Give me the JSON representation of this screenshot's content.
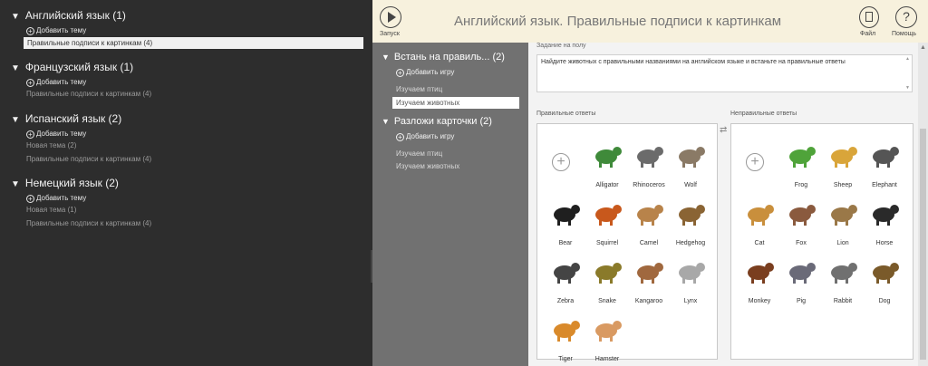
{
  "tree": {
    "languages": [
      {
        "title": "Английский язык (1)",
        "add_label": "Добавить тему",
        "topics": [
          "Правильные подписи к картинкам (4)"
        ],
        "selected": 0
      },
      {
        "title": "Французский язык (1)",
        "add_label": "Добавить тему",
        "topics": [
          "Правильные подписи к картинкам (4)"
        ],
        "selected": -1
      },
      {
        "title": "Испанский язык (2)",
        "add_label": "Добавить тему",
        "topics": [
          "Новая тема (2)",
          "Правильные подписи к картинкам (4)"
        ],
        "selected": -1
      },
      {
        "title": "Немецкий язык (2)",
        "add_label": "Добавить тему",
        "topics": [
          "Новая тема (1)",
          "Правильные подписи к картинкам (4)"
        ],
        "selected": -1
      }
    ]
  },
  "games": [
    {
      "title": "Встань на правиль... (2)",
      "add_label": "Добавить игру",
      "topics": [
        "Изучаем птиц",
        "Изучаем животных"
      ],
      "selected": 1
    },
    {
      "title": "Разложи карточки (2)",
      "add_label": "Добавить игру",
      "topics": [
        "Изучаем птиц",
        "Изучаем животных"
      ],
      "selected": -1
    }
  ],
  "toolbar": {
    "run_label": "Запуск",
    "title": "Английский язык. Правильные подписи к картинкам",
    "file_label": "Файл",
    "help_label": "Помощь"
  },
  "task": {
    "label": "Задание на полу",
    "text": "Найдите животных с правильными названиями на английском языке и встаньте на правильные ответы"
  },
  "answers": {
    "correct_label": "Правильные ответы",
    "wrong_label": "Неправильные ответы",
    "correct": [
      "Alligator",
      "Rhinoceros",
      "Wolf",
      "Bear",
      "Squirrel",
      "Camel",
      "Hedgehog",
      "Zebra",
      "Snake",
      "Kangaroo",
      "Lynx",
      "Tiger",
      "Hamster"
    ],
    "wrong": [
      "Frog",
      "Sheep",
      "Elephant",
      "Cat",
      "Fox",
      "Lion",
      "Horse",
      "Monkey",
      "Pig",
      "Rabbit",
      "Dog"
    ]
  },
  "colors": {
    "left_bg": "#2d2d2d",
    "mid_bg": "#717171",
    "topbar_bg": "#f7f1dd",
    "content_bg": "#f3f3f3"
  }
}
